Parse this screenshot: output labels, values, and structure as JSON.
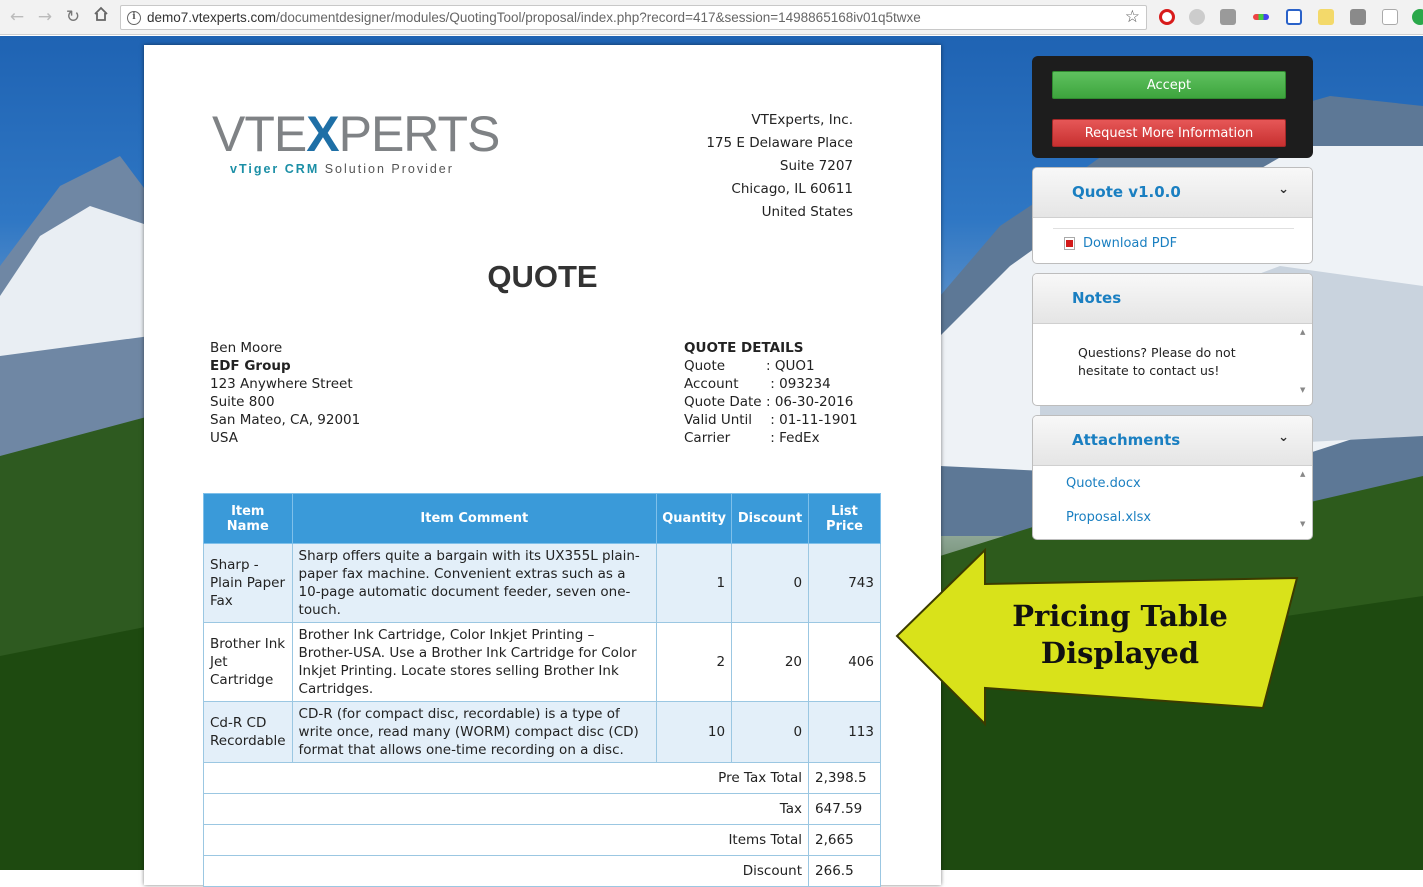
{
  "browser": {
    "url_host": "demo7.vtexperts.com",
    "url_path": "/documentdesigner/modules/QuotingTool/proposal/index.php?record=417&session=1498865168iv01q5twxe"
  },
  "document": {
    "logo": {
      "mark_left": "VTE",
      "mark_x": "X",
      "mark_right": "PERTS",
      "tagline_a": "vTiger CRM",
      "tagline_b": "Solution Provider"
    },
    "company": [
      "VTExperts, Inc.",
      "175 E Delaware Place",
      "Suite 7207",
      "Chicago, IL 60611",
      "United States"
    ],
    "title": "QUOTE",
    "customer": {
      "name": "Ben Moore",
      "org": "EDF Group",
      "street": "123 Anywhere Street",
      "suite": "Suite 800",
      "city": "San Mateo, CA, 92001",
      "country": "USA"
    },
    "details": {
      "heading": "QUOTE DETAILS",
      "rows": [
        {
          "label": "Quote",
          "value": ": QUO1"
        },
        {
          "label": "Account",
          "value": " : 093234"
        },
        {
          "label": "Quote Date",
          "value": ": 06-30-2016"
        },
        {
          "label": "Valid Until",
          "value": " : 01-11-1901"
        },
        {
          "label": "Carrier",
          "value": " : FedEx"
        }
      ]
    },
    "table": {
      "headers": [
        "Item Name",
        "Item Comment",
        "Quantity",
        "Discount",
        "List Price"
      ],
      "rows": [
        {
          "name": "Sharp - Plain Paper Fax",
          "comment": "Sharp offers quite a bargain with its UX355L plain-paper fax machine. Convenient extras such as a 10-page automatic document feeder, seven one-touch.",
          "quantity": "1",
          "discount": "0",
          "price": "743"
        },
        {
          "name": "Brother Ink Jet Cartridge",
          "comment": "Brother Ink Cartridge, Color Inkjet Printing – Brother-USA. Use a Brother Ink Cartridge for Color Inkjet Printing. Locate stores selling Brother Ink Cartridges.",
          "quantity": "2",
          "discount": "20",
          "price": "406"
        },
        {
          "name": "Cd-R CD Recordable",
          "comment": "CD-R (for compact disc, recordable) is a type of write once, read many (WORM) compact disc (CD) format that allows one-time recording on a disc.",
          "quantity": "10",
          "discount": "0",
          "price": "113"
        }
      ],
      "totals": [
        {
          "label": "Pre Tax Total",
          "value": "2,398.5"
        },
        {
          "label": "Tax",
          "value": "647.59"
        },
        {
          "label": "Items Total",
          "value": "2,665"
        },
        {
          "label": "Discount",
          "value": "266.5"
        }
      ]
    }
  },
  "sidebar": {
    "accept_label": "Accept",
    "request_info_label": "Request More Information",
    "quote_panel": {
      "title": "Quote v1.0.0",
      "download_label": "Download PDF"
    },
    "notes_panel": {
      "title": "Notes",
      "text": "Questions? Please do not hesitate to contact us!"
    },
    "attachments_panel": {
      "title": "Attachments",
      "files": [
        "Quote.docx",
        "Proposal.xlsx"
      ]
    }
  },
  "annotation": {
    "line1": "Pricing Table",
    "line2": "Displayed",
    "color": "#d9e21a"
  },
  "colors": {
    "accent": "#1a7fc1",
    "table_header": "#3a9ad9",
    "accept": "#4cb34c",
    "request": "#d63c3c"
  }
}
